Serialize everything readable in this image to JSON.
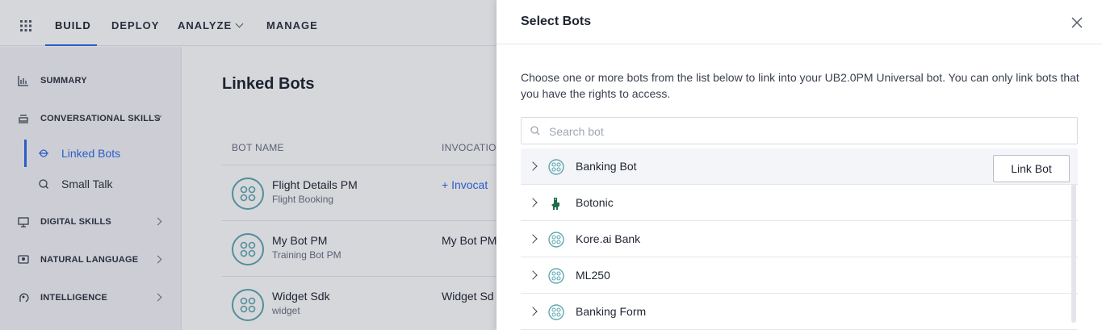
{
  "topnav": {
    "items": [
      {
        "label": "BUILD",
        "active": true
      },
      {
        "label": "DEPLOY"
      },
      {
        "label": "ANALYZE",
        "has_dropdown": true
      },
      {
        "label": "MANAGE"
      }
    ]
  },
  "sidebar": {
    "items": [
      {
        "label": "SUMMARY",
        "icon": "bar-chart-icon"
      },
      {
        "label": "CONVERSATIONAL SKILLS",
        "icon": "stack-icon",
        "expanded": true
      },
      {
        "label": "DIGITAL SKILLS",
        "icon": "monitor-icon"
      },
      {
        "label": "NATURAL LANGUAGE",
        "icon": "speech-icon"
      },
      {
        "label": "INTELLIGENCE",
        "icon": "brain-icon"
      }
    ],
    "subitems": [
      {
        "label": "Linked Bots",
        "icon": "link-icon",
        "active": true
      },
      {
        "label": "Small Talk",
        "icon": "chat-icon"
      }
    ]
  },
  "main": {
    "title": "Linked Bots",
    "columns": [
      "BOT NAME",
      "INVOCATION"
    ],
    "rows": [
      {
        "name": "Flight Details PM",
        "subtitle": "Flight Booking",
        "invocation": "+ Invocat",
        "invocation_is_link": true
      },
      {
        "name": "My Bot PM",
        "subtitle": "Training Bot PM",
        "invocation": "My Bot PM"
      },
      {
        "name": "Widget Sdk",
        "subtitle": "widget",
        "invocation": "Widget Sd"
      }
    ]
  },
  "panel": {
    "title": "Select Bots",
    "description": "Choose one or more bots from the list below to link into your UB2.0PM Universal bot. You can only link bots that you have the rights to access.",
    "search_placeholder": "Search bot",
    "link_button_label": "Link Bot",
    "bots": [
      {
        "name": "Banking Bot",
        "icon": "bot-icon"
      },
      {
        "name": "Botonic",
        "icon": "dino-icon"
      },
      {
        "name": "Kore.ai Bank",
        "icon": "bot-icon"
      },
      {
        "name": "ML250",
        "icon": "bot-icon"
      },
      {
        "name": "Banking Form",
        "icon": "bot-icon"
      }
    ]
  },
  "colors": {
    "accent": "#2e6be6",
    "bot_icon": "#5fa8b0",
    "dino_icon": "#1f6b4a"
  }
}
